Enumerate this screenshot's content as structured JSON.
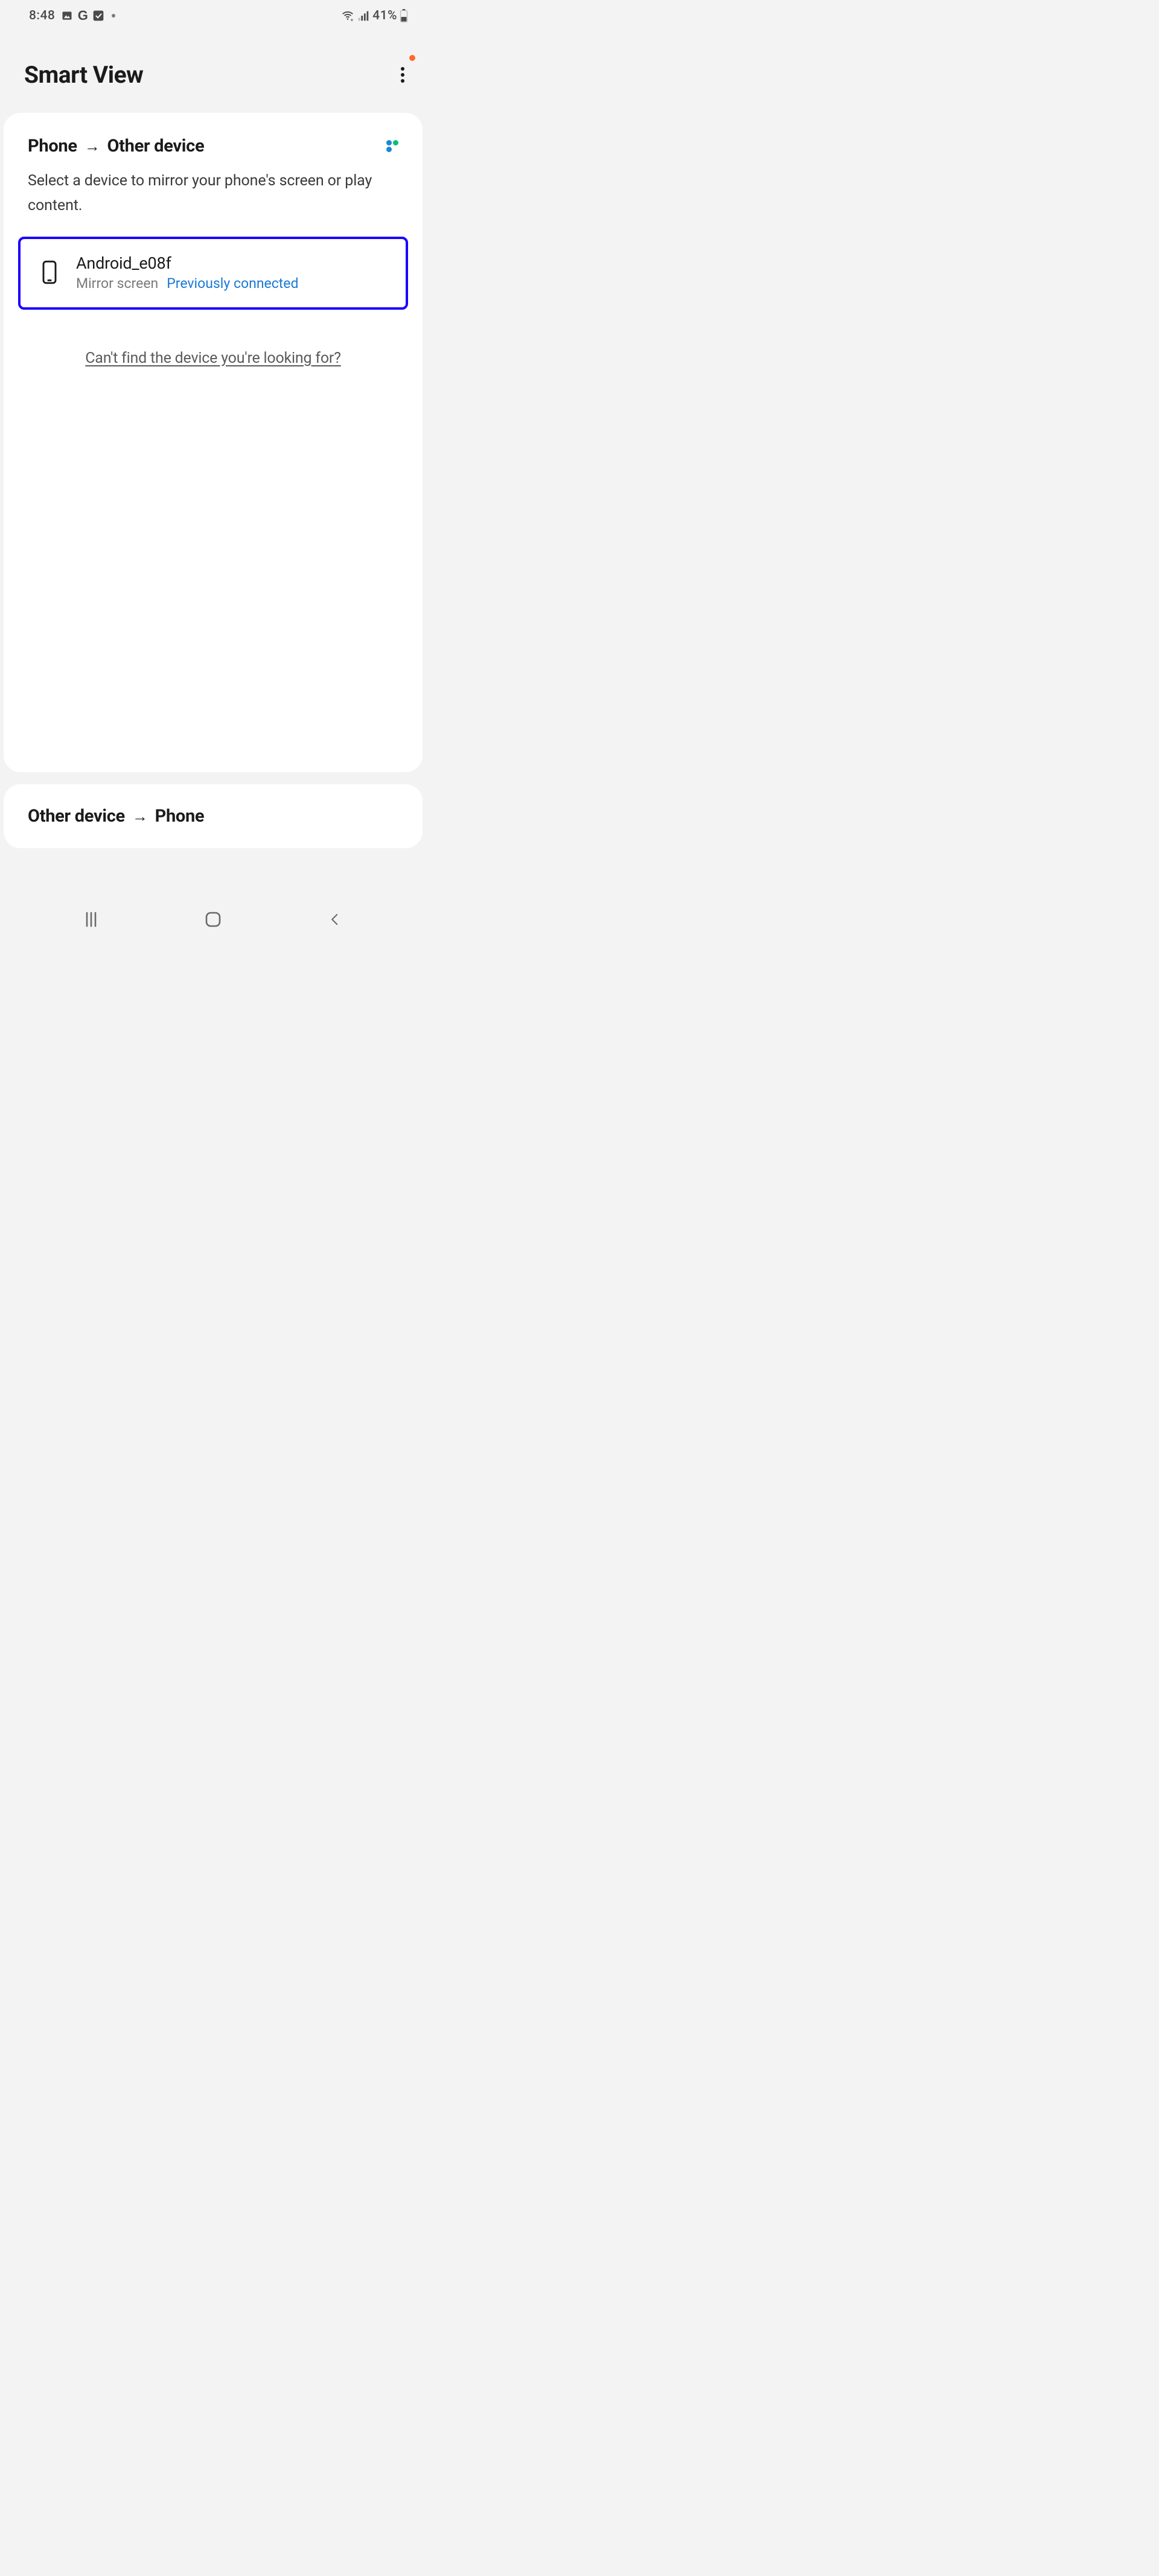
{
  "status_bar": {
    "time": "8:48",
    "battery_text": "41%"
  },
  "header": {
    "title": "Smart View"
  },
  "section1": {
    "title_from": "Phone",
    "title_to": "Other device",
    "desc": "Select a device to mirror your phone's screen or play content.",
    "device": {
      "name": "Android_e08f",
      "sub1": "Mirror screen",
      "sub2": "Previously connected"
    },
    "help": "Can't find the device you're looking for?"
  },
  "section2": {
    "title_from": "Other device",
    "title_to": "Phone"
  },
  "colors": {
    "sm_dot_a": "#1887d6",
    "sm_dot_b": "#00c07a",
    "sm_dot_c": "#1887d6",
    "sm_dot_d": "#1887d6"
  }
}
